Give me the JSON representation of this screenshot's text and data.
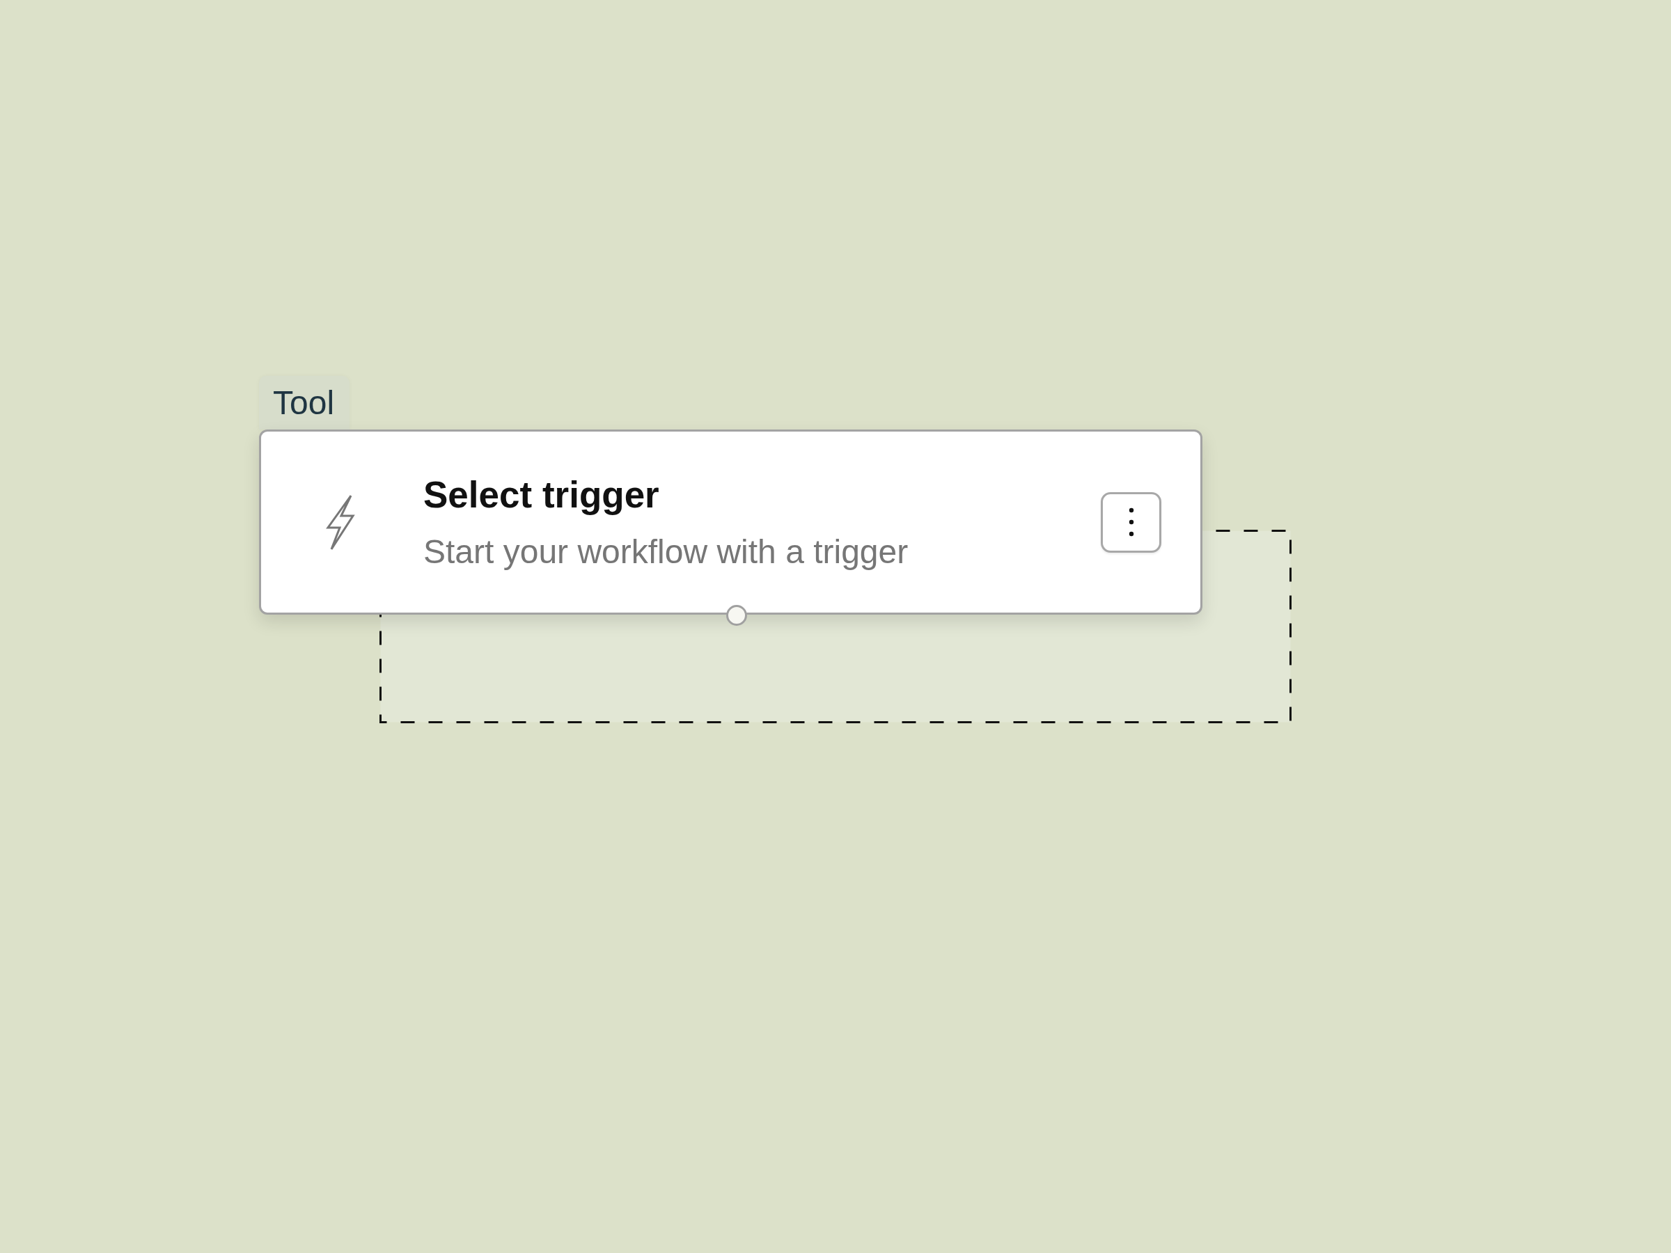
{
  "canvas": {
    "node": {
      "tag": "Tool",
      "title": "Select trigger",
      "subtitle": "Start your workflow with a trigger"
    }
  }
}
